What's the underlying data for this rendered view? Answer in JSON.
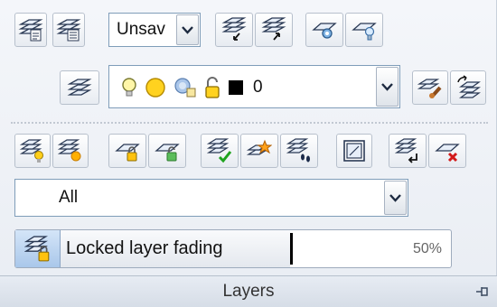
{
  "toolbar": {
    "layer_state_value": "Unsav",
    "current_layer": {
      "name": "0",
      "icons": [
        "lightbulb-on-icon",
        "sun-thawed-icon",
        "viewport-sun-icon",
        "lock-unlocked-icon",
        "color-swatch-icon"
      ],
      "color": "#000000"
    },
    "layer_filter_value": "All"
  },
  "fade": {
    "label": "Locked layer fading",
    "value_text": "50%",
    "value": 50
  },
  "panel": {
    "title": "Layers"
  }
}
